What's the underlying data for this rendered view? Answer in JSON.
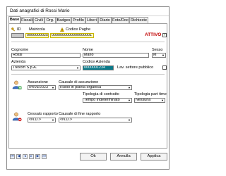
{
  "window": {
    "title": "Dati anagrafici di Rossi Mario"
  },
  "tabs": [
    {
      "label": "Base"
    },
    {
      "label": "Fiscali"
    },
    {
      "label": "Civili"
    },
    {
      "label": "Org."
    },
    {
      "label": "Badges"
    },
    {
      "label": "Profilo"
    },
    {
      "label": "Liberi"
    },
    {
      "label": "Diario"
    },
    {
      "label": "Foto/Doc"
    },
    {
      "label": "Richieste"
    }
  ],
  "ids": {
    "id_label": "ID",
    "matricola_label": "Matricola",
    "codice_paghe_label": "Codice Paghe",
    "id_value": "",
    "matricola_value": "0000000025",
    "codice_paghe_value": "0000000000000000001",
    "attivo_label": "ATTIVO",
    "attivo_checked": "✓"
  },
  "person": {
    "cognome_label": "Cognome",
    "cognome_value": "Rossi",
    "nome_label": "Nome",
    "nome_value": "Mario",
    "sesso_label": "Sesso",
    "sesso_value": "M"
  },
  "company": {
    "azienda_label": "Azienda",
    "azienda_value": "Trexom S.p.A.",
    "codice_label": "Codice Azienda",
    "codice_value": "0000001234",
    "lav_pubblico_label": "Lav. settore pubblico"
  },
  "hire": {
    "assunzione_label": "Assunzione",
    "assunzione_value": "04/09/2023",
    "causale_label": "Causale di assunzione",
    "causale_value": "Ruolo in pianta organica",
    "tipologia_label": "Tipologia di contratto",
    "tipologia_value": "Tempo Indeterminato",
    "parttime_label": "Tipologia part time",
    "parttime_value": "Nessuna"
  },
  "termination": {
    "cessato_label": "Cessato rapporto",
    "cessato_value": "<N.D.>",
    "causale_fine_label": "Causale di fine rapporto",
    "causale_fine_value": "<N.D.>"
  },
  "footer": {
    "nav_first": "⏮",
    "nav_prev2": "◀",
    "nav_prev": "◂",
    "nav_next": "▸",
    "nav_next2": "▶",
    "nav_last": "⏭",
    "ok_label": "Ok",
    "annulla_label": "Annulla",
    "applica_label": "Applica"
  }
}
